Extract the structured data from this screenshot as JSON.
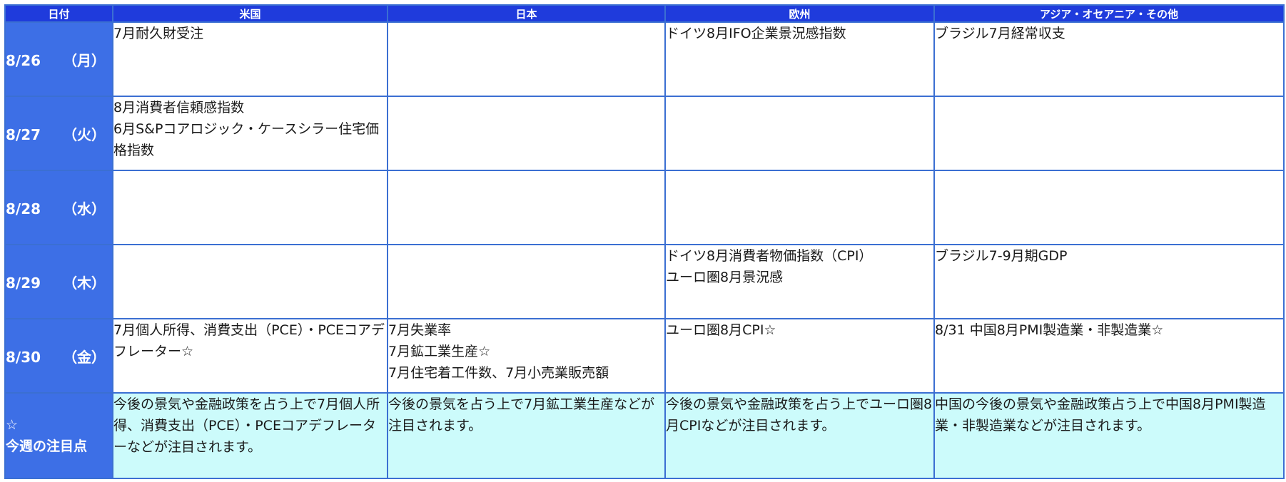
{
  "header": {
    "date": "日付",
    "us": "米国",
    "japan": "日本",
    "europe": "欧州",
    "asia": "アジア・オセアニア・その他"
  },
  "rows": [
    {
      "date": "8/26",
      "weekday": "（月）",
      "us": [
        "7月耐久財受注"
      ],
      "japan": [],
      "europe": [
        "ドイツ8月IFO企業景況感指数"
      ],
      "asia": [
        "ブラジル7月経常収支"
      ]
    },
    {
      "date": "8/27",
      "weekday": "（火）",
      "us": [
        "8月消費者信頼感指数",
        "6月S&Pコアロジック・ケースシラー住宅価格指数"
      ],
      "japan": [],
      "europe": [],
      "asia": []
    },
    {
      "date": "8/28",
      "weekday": "（水）",
      "us": [],
      "japan": [],
      "europe": [],
      "asia": []
    },
    {
      "date": "8/29",
      "weekday": "（木）",
      "us": [],
      "japan": [],
      "europe": [
        "ドイツ8月消費者物価指数（CPI）",
        "ユーロ圏8月景況感"
      ],
      "asia": [
        "ブラジル7-9月期GDP"
      ]
    },
    {
      "date": "8/30",
      "weekday": "（金）",
      "us": [
        "7月個人所得、消費支出（PCE）・PCEコアデフレーター☆"
      ],
      "japan": [
        "7月失業率",
        "7月鉱工業生産☆",
        "7月住宅着工件数、7月小売業販売額"
      ],
      "europe": [
        "ユーロ圏8月CPI☆"
      ],
      "asia": [
        "8/31 中国8月PMI製造業・非製造業☆"
      ]
    }
  ],
  "notes": {
    "star": "☆",
    "label": "今週の注目点",
    "us": "今後の景気や金融政策を占う上で7月個人所得、消費支出（PCE）・PCEコアデフレーターなどが注目されます。",
    "japan": "今後の景気を占う上で7月鉱工業生産などが注目されます。",
    "europe": "今後の景気や金融政策を占う上でユーロ圏8月CPIなどが注目されます。",
    "asia": "中国の今後の景気や金融政策占う上で中国8月PMI製造業・非製造業などが注目されます。"
  }
}
